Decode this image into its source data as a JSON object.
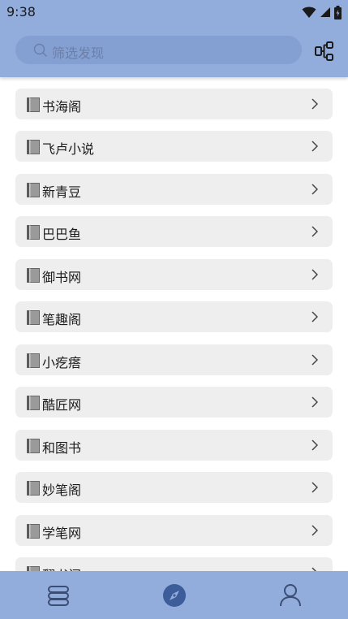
{
  "status_bar": {
    "time": "9:38"
  },
  "search": {
    "placeholder": "筛选发现"
  },
  "sources": [
    {
      "label": "书海阁"
    },
    {
      "label": "飞卢小说"
    },
    {
      "label": "新青豆"
    },
    {
      "label": "巴巴鱼"
    },
    {
      "label": "御书网"
    },
    {
      "label": "笔趣阁"
    },
    {
      "label": "小疙瘩"
    },
    {
      "label": "酷匠网"
    },
    {
      "label": "和图书"
    },
    {
      "label": "妙笔阁"
    },
    {
      "label": "学笔网"
    },
    {
      "label": "翻书阁"
    }
  ],
  "bottom_nav": {
    "items": [
      {
        "icon": "bookshelf-icon"
      },
      {
        "icon": "compass-icon",
        "active": true
      },
      {
        "icon": "profile-icon"
      }
    ]
  },
  "colors": {
    "header": "#92ADDB",
    "search_box": "#84A0D2",
    "item_bg": "#EEEEEE",
    "active_nav": "#3D5C9A",
    "nav_icon": "#3a4d75"
  }
}
